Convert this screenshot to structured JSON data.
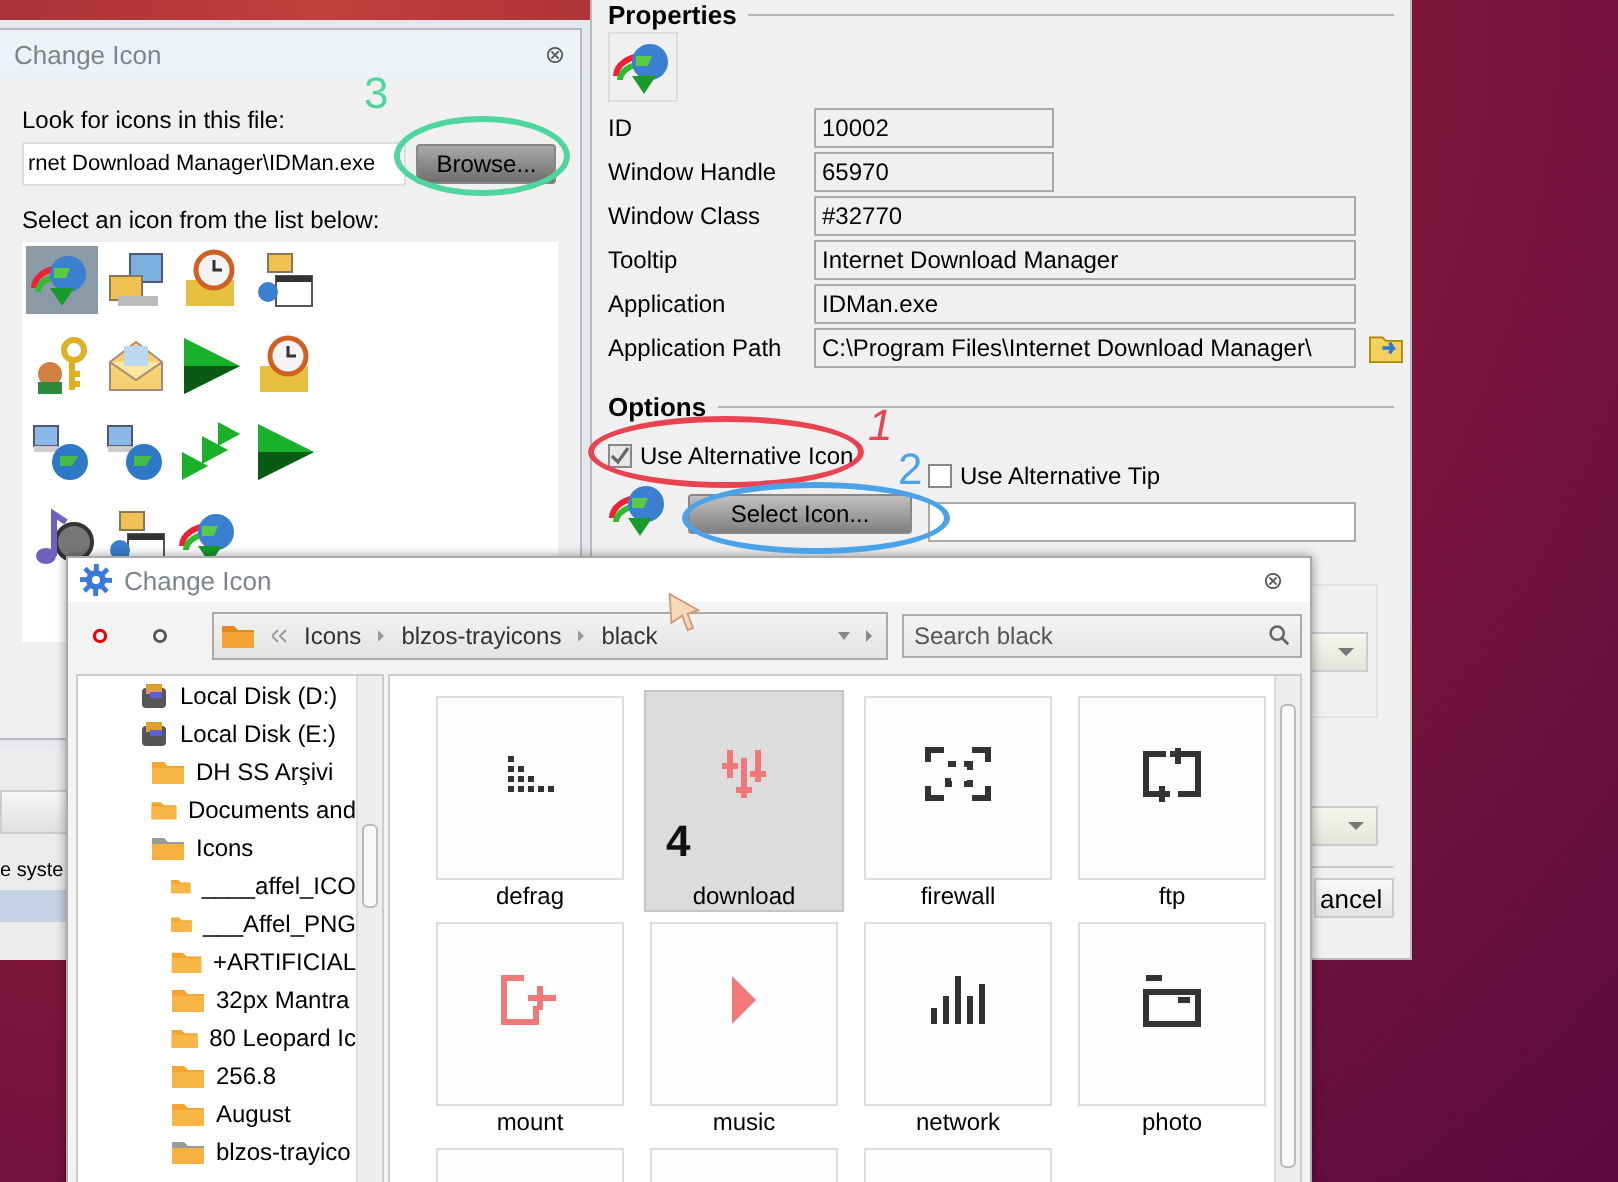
{
  "back_window": {
    "title": "Change Icon",
    "file_label": "Look for icons in this file:",
    "file_value": "rnet Download Manager\\IDMan.exe",
    "browse_button": "Browse...",
    "list_label": "Select an icon from the list below:",
    "icons": [
      {
        "selected": true
      },
      {
        "selected": false
      },
      {
        "selected": false
      },
      {
        "selected": false
      },
      {
        "selected": false
      },
      {
        "selected": false
      },
      {
        "selected": false
      },
      {
        "selected": false
      },
      {
        "selected": false
      },
      {
        "selected": false
      },
      {
        "selected": false
      },
      {
        "selected": false
      },
      {
        "selected": false
      },
      {
        "selected": false
      },
      {
        "selected": false
      }
    ]
  },
  "background_text": "e syste",
  "properties": {
    "heading": "Properties",
    "fields": [
      {
        "label": "ID",
        "value": "10002"
      },
      {
        "label": "Window Handle",
        "value": "65970"
      },
      {
        "label": "Window Class",
        "value": "#32770"
      },
      {
        "label": "Tooltip",
        "value": "Internet Download Manager"
      },
      {
        "label": "Application",
        "value": "IDMan.exe"
      },
      {
        "label": "Application Path",
        "value": "C:\\Program Files\\Internet Download Manager\\"
      }
    ],
    "options_heading": "Options",
    "use_alt_icon": {
      "label": "Use Alternative Icon",
      "checked": true
    },
    "select_icon_button": "Select Icon...",
    "use_alt_tip": {
      "label": "Use Alternative Tip",
      "checked": false
    },
    "cancel_button": "ancel"
  },
  "picker": {
    "title": "Change Icon",
    "breadcrumb": [
      "Icons",
      "blzos-trayicons",
      "black"
    ],
    "search": {
      "placeholder": "Search black"
    },
    "tree": [
      {
        "label": "Local Disk (D:)",
        "kind": "disk"
      },
      {
        "label": "Local Disk (E:)",
        "kind": "disk",
        "children": [
          {
            "label": "DH SS Arşivi",
            "kind": "folder"
          },
          {
            "label": "Documents and",
            "kind": "folder"
          },
          {
            "label": "Icons",
            "kind": "open-folder",
            "children": [
              {
                "label": "____affel_ICO",
                "kind": "folder"
              },
              {
                "label": "___Affel_PNG",
                "kind": "folder"
              },
              {
                "label": "+ARTIFICIAL",
                "kind": "folder"
              },
              {
                "label": "32px Mantra",
                "kind": "folder"
              },
              {
                "label": "80 Leopard Ic",
                "kind": "folder"
              },
              {
                "label": "256.8",
                "kind": "folder"
              },
              {
                "label": "August",
                "kind": "folder"
              },
              {
                "label": "blzos-trayico",
                "kind": "open-folder"
              }
            ]
          }
        ]
      }
    ],
    "tiles": [
      {
        "label": "defrag",
        "selected": false,
        "color": "#333333"
      },
      {
        "label": "download",
        "selected": true,
        "color": "#f07878"
      },
      {
        "label": "firewall",
        "selected": false,
        "color": "#333333"
      },
      {
        "label": "ftp",
        "selected": false,
        "color": "#333333"
      },
      {
        "label": "mount",
        "selected": false,
        "color": "#f07878"
      },
      {
        "label": "music",
        "selected": false,
        "color": "#f07878"
      },
      {
        "label": "network",
        "selected": false,
        "color": "#333333"
      },
      {
        "label": "photo",
        "selected": false,
        "color": "#333333"
      },
      {
        "selected": false
      },
      {
        "selected": false
      },
      {
        "selected": false
      }
    ]
  },
  "annotations": [
    {
      "label": "1",
      "color": "#e8434f"
    },
    {
      "label": "2",
      "color": "#4aa3e8"
    },
    {
      "label": "3",
      "color": "#4fd6a0"
    },
    {
      "label": "4",
      "color": "#111111"
    }
  ]
}
